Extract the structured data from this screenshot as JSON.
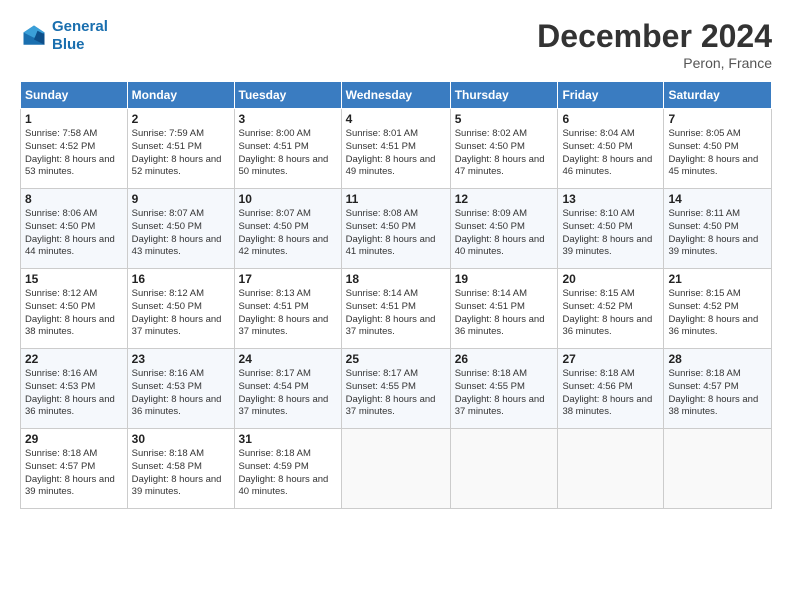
{
  "header": {
    "logo_line1": "General",
    "logo_line2": "Blue",
    "main_title": "December 2024",
    "subtitle": "Peron, France"
  },
  "calendar": {
    "days_of_week": [
      "Sunday",
      "Monday",
      "Tuesday",
      "Wednesday",
      "Thursday",
      "Friday",
      "Saturday"
    ],
    "weeks": [
      [
        {
          "day": "1",
          "sunrise": "7:58 AM",
          "sunset": "4:52 PM",
          "daylight": "8 hours and 53 minutes."
        },
        {
          "day": "2",
          "sunrise": "7:59 AM",
          "sunset": "4:51 PM",
          "daylight": "8 hours and 52 minutes."
        },
        {
          "day": "3",
          "sunrise": "8:00 AM",
          "sunset": "4:51 PM",
          "daylight": "8 hours and 50 minutes."
        },
        {
          "day": "4",
          "sunrise": "8:01 AM",
          "sunset": "4:51 PM",
          "daylight": "8 hours and 49 minutes."
        },
        {
          "day": "5",
          "sunrise": "8:02 AM",
          "sunset": "4:50 PM",
          "daylight": "8 hours and 47 minutes."
        },
        {
          "day": "6",
          "sunrise": "8:04 AM",
          "sunset": "4:50 PM",
          "daylight": "8 hours and 46 minutes."
        },
        {
          "day": "7",
          "sunrise": "8:05 AM",
          "sunset": "4:50 PM",
          "daylight": "8 hours and 45 minutes."
        }
      ],
      [
        {
          "day": "8",
          "sunrise": "8:06 AM",
          "sunset": "4:50 PM",
          "daylight": "8 hours and 44 minutes."
        },
        {
          "day": "9",
          "sunrise": "8:07 AM",
          "sunset": "4:50 PM",
          "daylight": "8 hours and 43 minutes."
        },
        {
          "day": "10",
          "sunrise": "8:07 AM",
          "sunset": "4:50 PM",
          "daylight": "8 hours and 42 minutes."
        },
        {
          "day": "11",
          "sunrise": "8:08 AM",
          "sunset": "4:50 PM",
          "daylight": "8 hours and 41 minutes."
        },
        {
          "day": "12",
          "sunrise": "8:09 AM",
          "sunset": "4:50 PM",
          "daylight": "8 hours and 40 minutes."
        },
        {
          "day": "13",
          "sunrise": "8:10 AM",
          "sunset": "4:50 PM",
          "daylight": "8 hours and 39 minutes."
        },
        {
          "day": "14",
          "sunrise": "8:11 AM",
          "sunset": "4:50 PM",
          "daylight": "8 hours and 39 minutes."
        }
      ],
      [
        {
          "day": "15",
          "sunrise": "8:12 AM",
          "sunset": "4:50 PM",
          "daylight": "8 hours and 38 minutes."
        },
        {
          "day": "16",
          "sunrise": "8:12 AM",
          "sunset": "4:50 PM",
          "daylight": "8 hours and 37 minutes."
        },
        {
          "day": "17",
          "sunrise": "8:13 AM",
          "sunset": "4:51 PM",
          "daylight": "8 hours and 37 minutes."
        },
        {
          "day": "18",
          "sunrise": "8:14 AM",
          "sunset": "4:51 PM",
          "daylight": "8 hours and 37 minutes."
        },
        {
          "day": "19",
          "sunrise": "8:14 AM",
          "sunset": "4:51 PM",
          "daylight": "8 hours and 36 minutes."
        },
        {
          "day": "20",
          "sunrise": "8:15 AM",
          "sunset": "4:52 PM",
          "daylight": "8 hours and 36 minutes."
        },
        {
          "day": "21",
          "sunrise": "8:15 AM",
          "sunset": "4:52 PM",
          "daylight": "8 hours and 36 minutes."
        }
      ],
      [
        {
          "day": "22",
          "sunrise": "8:16 AM",
          "sunset": "4:53 PM",
          "daylight": "8 hours and 36 minutes."
        },
        {
          "day": "23",
          "sunrise": "8:16 AM",
          "sunset": "4:53 PM",
          "daylight": "8 hours and 36 minutes."
        },
        {
          "day": "24",
          "sunrise": "8:17 AM",
          "sunset": "4:54 PM",
          "daylight": "8 hours and 37 minutes."
        },
        {
          "day": "25",
          "sunrise": "8:17 AM",
          "sunset": "4:55 PM",
          "daylight": "8 hours and 37 minutes."
        },
        {
          "day": "26",
          "sunrise": "8:18 AM",
          "sunset": "4:55 PM",
          "daylight": "8 hours and 37 minutes."
        },
        {
          "day": "27",
          "sunrise": "8:18 AM",
          "sunset": "4:56 PM",
          "daylight": "8 hours and 38 minutes."
        },
        {
          "day": "28",
          "sunrise": "8:18 AM",
          "sunset": "4:57 PM",
          "daylight": "8 hours and 38 minutes."
        }
      ],
      [
        {
          "day": "29",
          "sunrise": "8:18 AM",
          "sunset": "4:57 PM",
          "daylight": "8 hours and 39 minutes."
        },
        {
          "day": "30",
          "sunrise": "8:18 AM",
          "sunset": "4:58 PM",
          "daylight": "8 hours and 39 minutes."
        },
        {
          "day": "31",
          "sunrise": "8:18 AM",
          "sunset": "4:59 PM",
          "daylight": "8 hours and 40 minutes."
        },
        null,
        null,
        null,
        null
      ]
    ]
  }
}
